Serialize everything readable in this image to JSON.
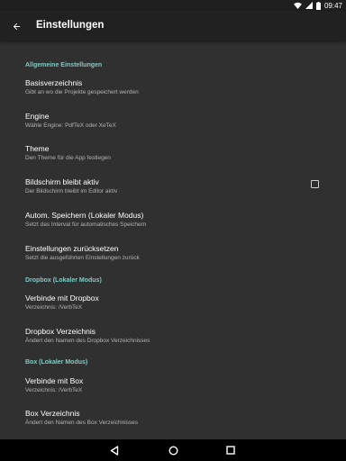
{
  "status_bar": {
    "time": "09:47",
    "icons": [
      "wifi-icon",
      "signal-icon",
      "battery-icon"
    ]
  },
  "toolbar": {
    "back_icon": "arrow-back-icon",
    "title": "Einstellungen"
  },
  "colors": {
    "background": "#303030",
    "toolbar": "#212121",
    "accent": "#80cbc4",
    "summary_text": "#b3b3b3"
  },
  "sections": [
    {
      "header": "Allgemeine Einstellungen",
      "items": [
        {
          "title": "Basisverzeichnis",
          "summary": "Gibt an wo die Projekte gespeichert werden"
        },
        {
          "title": "Engine",
          "summary": "Wähle Engine: PdfTeX oder XeTeX"
        },
        {
          "title": "Theme",
          "summary": "Den Theme für die App festlegen"
        },
        {
          "title": "Bildschirm bleibt aktiv",
          "summary": "Der Bildschirm bleibt im Editor aktiv",
          "checkbox": true,
          "checked": false
        },
        {
          "title": "Autom. Speichern (Lokaler Modus)",
          "summary": "Setzt das Interval für automatisches Speichern"
        },
        {
          "title": "Einstellungen zurücksetzen",
          "summary": "Setzt die ausgeführten Einstellungen zurück"
        }
      ]
    },
    {
      "header": "Dropbox (Lokaler Modus)",
      "items": [
        {
          "title": "Verbinde mit Dropbox",
          "summary": "Verzeichnis: /VerbTeX"
        },
        {
          "title": "Dropbox Verzeichnis",
          "summary": "Ändert den Namen des Dropbox Verzeichnisses"
        }
      ]
    },
    {
      "header": "Box (Lokaler Modus)",
      "items": [
        {
          "title": "Verbinde mit Box",
          "summary": "Verzeichnis: /VerbTeX"
        },
        {
          "title": "Box Verzeichnis",
          "summary": "Ändert den Namen des Box Verzeichnisses"
        }
      ]
    }
  ],
  "nav_bar": {
    "icons": [
      "back-triangle-icon",
      "home-circle-icon",
      "recents-square-icon"
    ]
  }
}
